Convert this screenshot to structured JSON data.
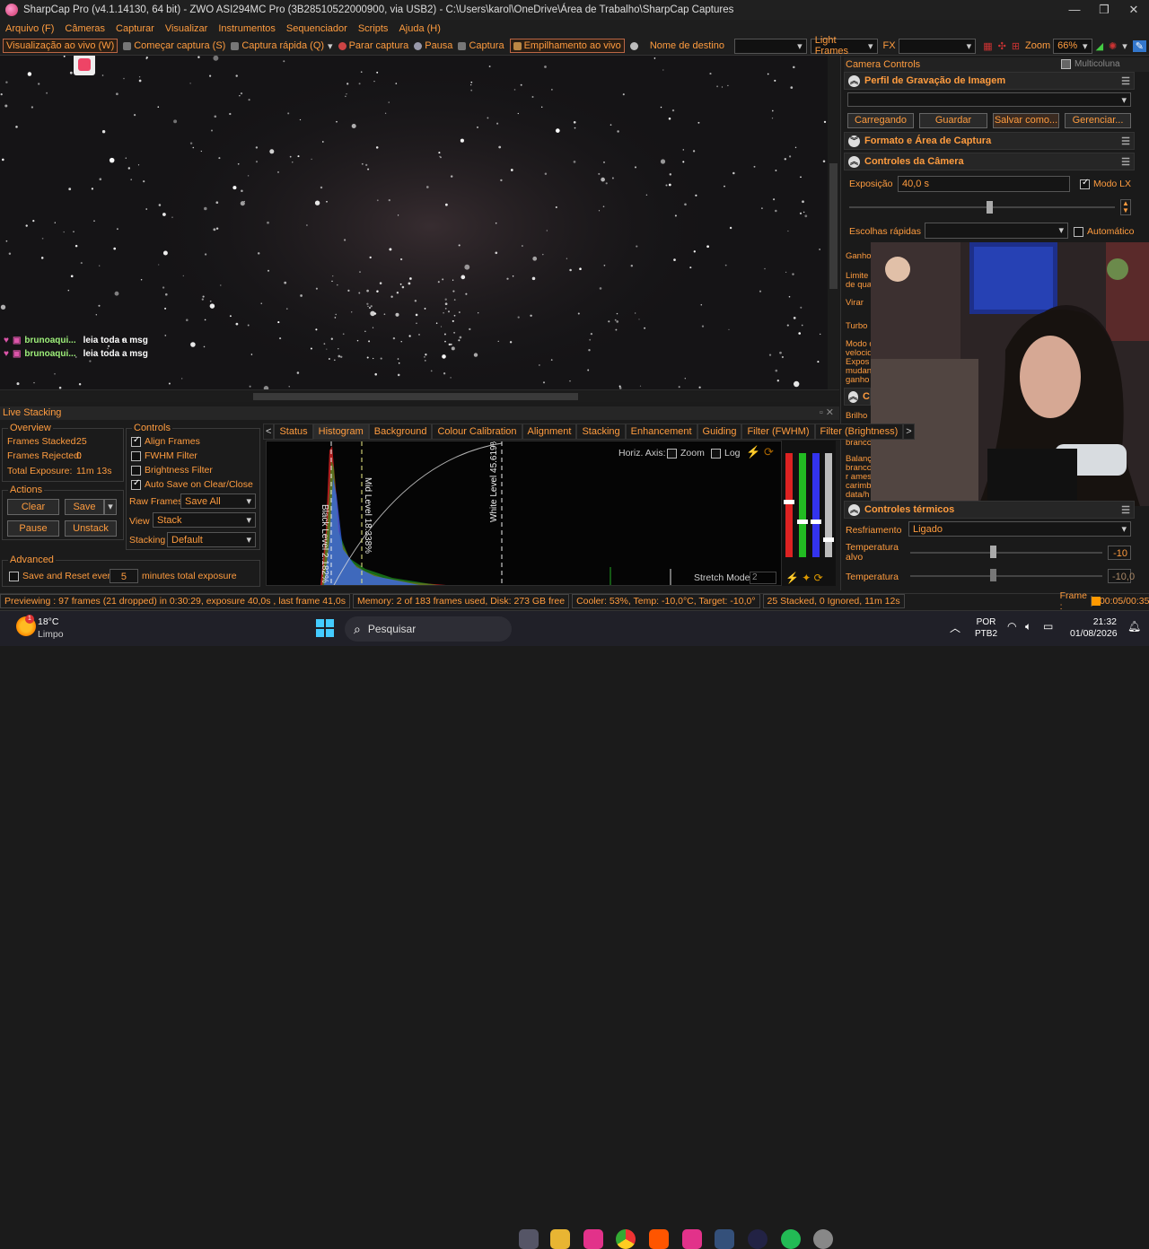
{
  "window": {
    "title": "SharpCap Pro (v4.1.14130, 64 bit) - ZWO ASI294MC Pro (3B28510522000900, via USB2) - C:\\Users\\karol\\OneDrive\\Área de Trabalho\\SharpCap Captures"
  },
  "menu": [
    "Arquivo (F)",
    "Câmeras",
    "Capturar",
    "Visualizar",
    "Instrumentos",
    "Sequenciador",
    "Scripts",
    "Ajuda (H)"
  ],
  "toolbar": {
    "live_view": "Visualização ao vivo (W)",
    "start_capture": "Começar captura (S)",
    "quick_capture": "Captura rápida (Q)",
    "stop_capture": "Parar captura",
    "pause": "Pausa",
    "capture": "Captura",
    "live_stacking": "Empilhamento ao vivo",
    "target_name": "Nome de destino",
    "frame_type": "Light Frames",
    "fx": "FX",
    "zoom_label": "Zoom",
    "zoom_value": "66%"
  },
  "chat": [
    {
      "user": "brunoaqui...",
      "message": "leia toda a msg"
    },
    {
      "user": "brunoaqui...",
      "message": "leia toda a msg"
    }
  ],
  "camera_controls": {
    "title": "Camera Controls",
    "multicolumn": "Multicoluna",
    "profile_section": "Perfil de Gravação de Imagem",
    "profile_buttons": [
      "Carregando",
      "Guardar",
      "Salvar como...",
      "Gerenciar..."
    ],
    "format_section": "Formato e Área de Captura",
    "camera_section": "Controles da Câmera",
    "exposure_label": "Exposição",
    "exposure_value": "40,0 s",
    "lx_mode": "Modo LX",
    "quick_picks": "Escolhas rápidas",
    "automatic": "Automático",
    "side_labels": [
      "Ganho",
      "Limite",
      "de qua",
      "Virar",
      "Turbo",
      "Modo d",
      "velocid",
      "Expos",
      "mudan",
      "ganho",
      "Brilho",
      "Balanç",
      "brancc",
      "Balanç",
      "brancc",
      "r ames",
      "carimb",
      "data/h"
    ],
    "thermal_section": "Controles térmicos",
    "cooling_label": "Resfriamento",
    "cooling_value": "Ligado",
    "target_temp_label": "Temperatura alvo",
    "target_temp_value": "-10",
    "temp_label": "Temperatura",
    "temp_value": "-10,0"
  },
  "live_stacking": {
    "title": "Live Stacking",
    "overview_title": "Overview",
    "frames_stacked_label": "Frames Stacked:",
    "frames_stacked": "25",
    "frames_rejected_label": "Frames Rejected:",
    "frames_rejected": "0",
    "total_exposure_label": "Total Exposure:",
    "total_exposure": "11m 13s",
    "controls_title": "Controls",
    "align_frames": "Align Frames",
    "fwhm_filter": "FWHM Filter",
    "brightness_filter": "Brightness Filter",
    "auto_save": "Auto Save on Clear/Close",
    "raw_frames_label": "Raw Frames",
    "raw_frames_value": "Save All",
    "view_label": "View",
    "view_value": "Stack",
    "stacking_label": "Stacking",
    "stacking_value": "Default",
    "actions_title": "Actions",
    "clear": "Clear",
    "save": "Save",
    "pause": "Pause",
    "unstack": "Unstack",
    "advanced_title": "Advanced",
    "save_reset": "Save and Reset every",
    "save_reset_value": "5",
    "minutes_total": "minutes total exposure",
    "tabs": [
      "Status",
      "Histogram",
      "Background",
      "Colour Calibration",
      "Alignment",
      "Stacking",
      "Enhancement",
      "Guiding",
      "Filter (FWHM)",
      "Filter (Brightness)"
    ],
    "active_tab": "Histogram",
    "horiz_axis": "Horiz. Axis:",
    "zoom": "Zoom",
    "log": "Log",
    "black_level": "Black Level 2.182%",
    "mid_level": "Mid Level 18.338%",
    "white_level": "White Level 45.619%",
    "stretch_mode": "Stretch Mode",
    "stretch_value": "2"
  },
  "status": {
    "preview": "Previewing : 97 frames (21 dropped) in 0:30:29, exposure 40,0s , last frame 41,0s",
    "memory": "Memory: 2 of 183 frames used, Disk: 273 GB free",
    "cooler": "Cooler: 53%, Temp: -10,0°C, Target: -10,0°",
    "stacked": "25 Stacked, 0 Ignored, 11m 12s",
    "frame_label": "Frame :",
    "frame_time": "00:05/00:35"
  },
  "taskbar": {
    "weather_temp": "18°C",
    "weather_desc": "Limpo",
    "weather_badge": "1",
    "search": "Pesquisar",
    "lang": "POR",
    "kbd": "PTB2",
    "time": "21:32",
    "date": "01/08/2026"
  },
  "colors": {
    "accent": "#ff9c3f",
    "bg": "#1b1b1b",
    "highlight": "#b64a2a"
  }
}
